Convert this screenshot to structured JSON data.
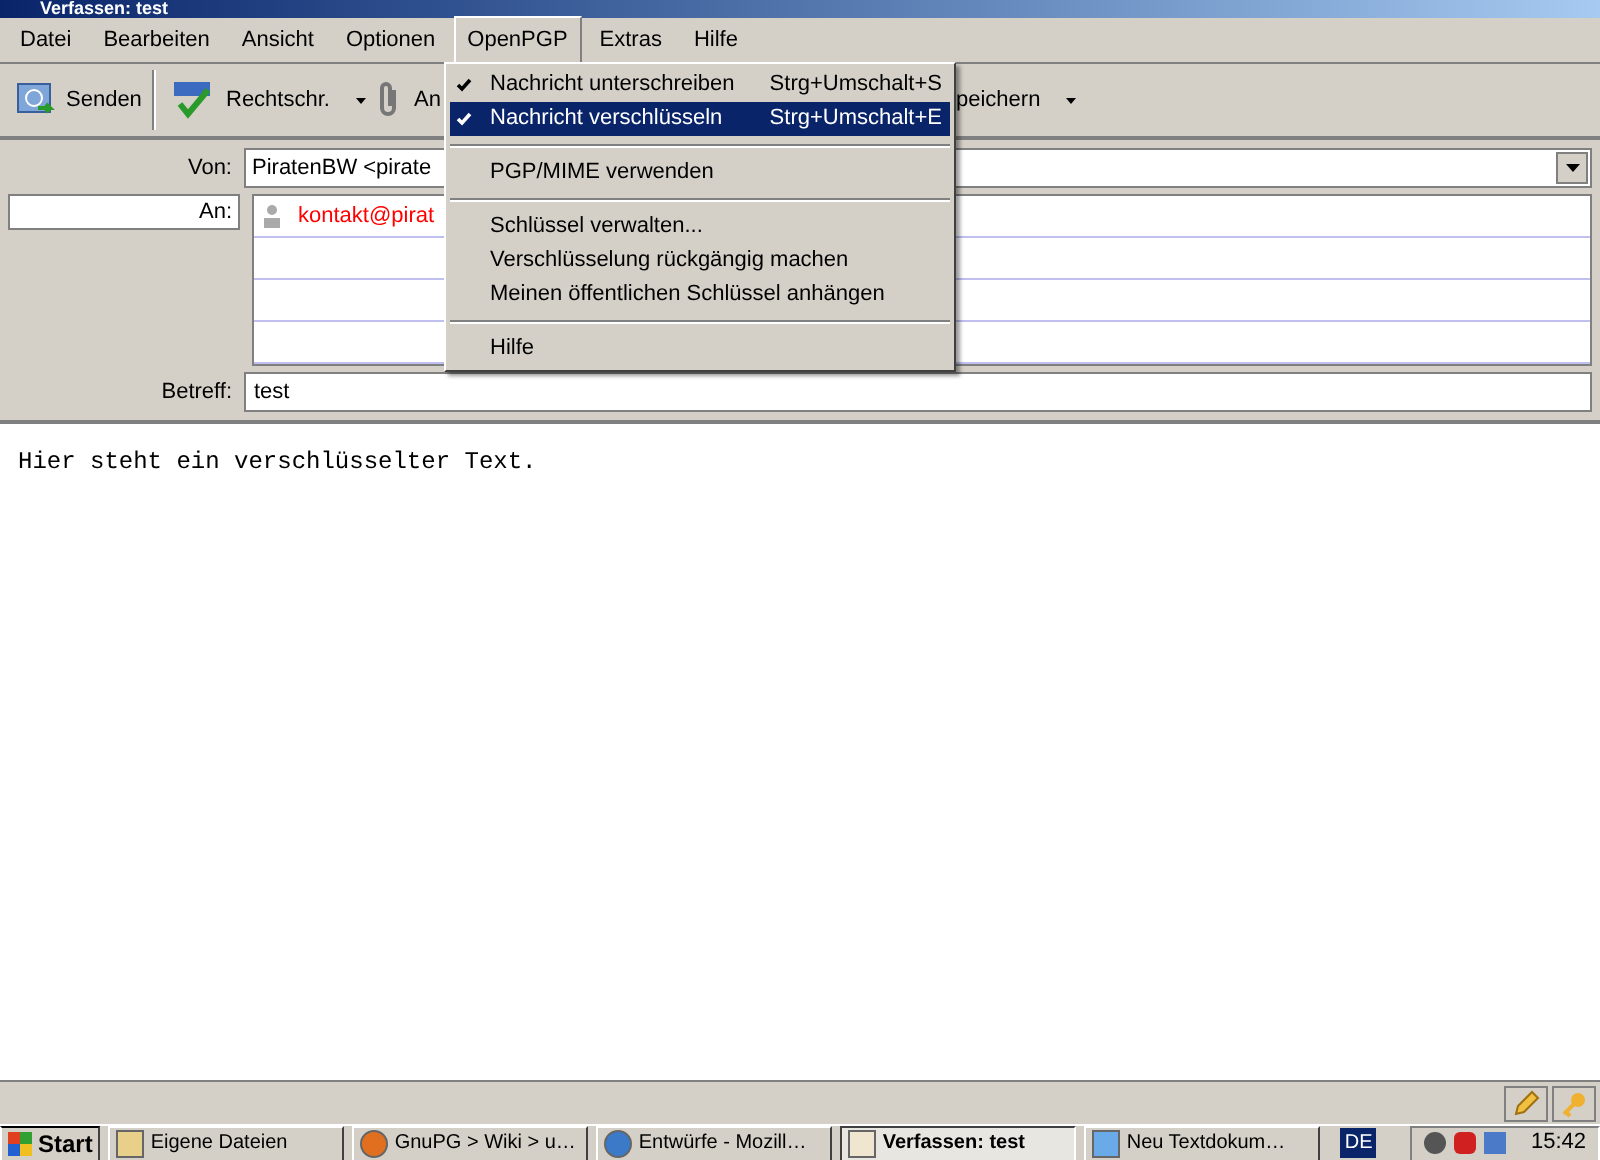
{
  "window": {
    "title": "Verfassen: test"
  },
  "menu_bar": [
    {
      "label": "Datei",
      "selected": false
    },
    {
      "label": "Bearbeiten",
      "selected": false
    },
    {
      "label": "Ansicht",
      "selected": false
    },
    {
      "label": "Optionen",
      "selected": false
    },
    {
      "label": "OpenPGP",
      "selected": true
    },
    {
      "label": "Extras",
      "selected": false
    },
    {
      "label": "Hilfe",
      "selected": false
    }
  ],
  "toolbar": [
    {
      "label": "Senden",
      "dropdown": false
    },
    {
      "label": "Rechtschr.",
      "dropdown": true
    },
    {
      "label": "An",
      "dropdown": false
    },
    {
      "label": "peichern",
      "dropdown": true
    }
  ],
  "header": {
    "from": {
      "label": "Von:",
      "value": "PiratenBW <pirate"
    },
    "to": {
      "label": "An:",
      "recipients": [
        "kontakt@pirat"
      ]
    },
    "subject": {
      "label": "Betreff:",
      "value": "test"
    }
  },
  "body": "Hier steht ein verschlüsselter Text.",
  "openpgp_menu": [
    {
      "kind": "check",
      "label": "Nachricht unterschreiben",
      "shortcut": "Strg+Umschalt+S",
      "checked": true,
      "selected": false
    },
    {
      "kind": "check",
      "label": "Nachricht verschlüsseln",
      "shortcut": "Strg+Umschalt+E",
      "checked": true,
      "selected": true
    },
    {
      "kind": "separator"
    },
    {
      "kind": "item",
      "label": "PGP/MIME verwenden",
      "selected": false
    },
    {
      "kind": "separator"
    },
    {
      "kind": "item",
      "label": "Schlüssel verwalten...",
      "selected": false
    },
    {
      "kind": "item",
      "label": "Verschlüsselung rückgängig machen",
      "selected": false
    },
    {
      "kind": "item",
      "label": "Meinen öffentlichen Schlüssel anhängen",
      "selected": false
    },
    {
      "kind": "separator"
    },
    {
      "kind": "item",
      "label": "Hilfe",
      "selected": false
    }
  ],
  "taskbar": {
    "start": "Start",
    "tasks": [
      {
        "label": "Eigene Dateien",
        "selected": false
      },
      {
        "label": "GnuPG > Wiki > u…",
        "selected": false
      },
      {
        "label": "Entwürfe - Mozill…",
        "selected": false
      },
      {
        "label": "Verfassen: test",
        "selected": true
      },
      {
        "label": "Neu Textdokum…",
        "selected": false
      }
    ],
    "language": "DE",
    "clock": "15:42"
  }
}
